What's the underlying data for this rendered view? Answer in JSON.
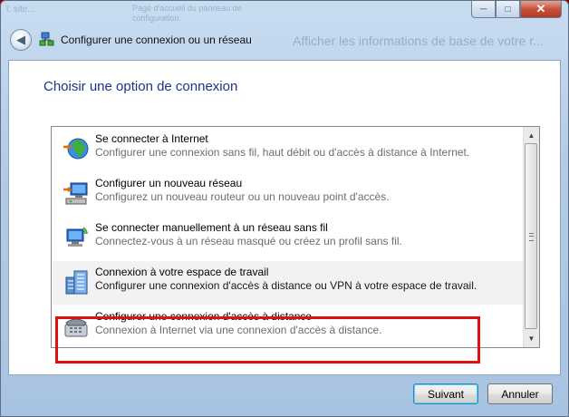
{
  "background": {
    "top_left_text": "l: site...",
    "back_window_crumb_1": "Page d'accueil du panneau de",
    "back_window_crumb_2": "configuration",
    "back_window_title": "Afficher les informations de base de votre r..."
  },
  "window_controls": {
    "minimize": "─",
    "maximize": "□",
    "close": "✕"
  },
  "nav": {
    "title": "Configurer une connexion ou un réseau",
    "back_symbol": "◀"
  },
  "main": {
    "heading": "Choisir une option de connexion"
  },
  "options": [
    {
      "title": "Se connecter à Internet",
      "desc": "Configurer une connexion sans fil, haut débit ou d'accès à distance à Internet.",
      "icon": "globe-network-icon"
    },
    {
      "title": "Configurer un nouveau réseau",
      "desc": "Configurez un nouveau routeur ou un nouveau point d'accès.",
      "icon": "new-network-icon"
    },
    {
      "title": "Se connecter manuellement à un réseau sans fil",
      "desc": "Connectez-vous à un réseau masqué ou créez un profil sans fil.",
      "icon": "wireless-computer-icon"
    },
    {
      "title": "Connexion à votre espace de travail",
      "desc": "Configurer une connexion d'accès à distance ou VPN à votre espace de travail.",
      "icon": "workplace-building-icon",
      "selected": true
    },
    {
      "title": "Configurer une connexion d'accès à distance",
      "desc": "Connexion à Internet via une connexion d'accès à distance.",
      "icon": "telephone-modem-icon"
    }
  ],
  "buttons": {
    "next": "Suivant",
    "cancel": "Annuler"
  },
  "colors": {
    "heading": "#1e3287",
    "highlight": "#e01010",
    "selected_row": "#f2f2f2"
  }
}
